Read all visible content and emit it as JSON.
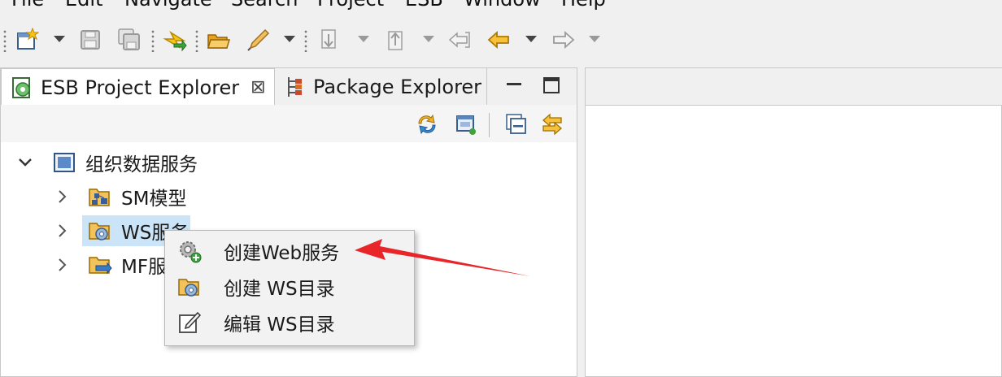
{
  "menubar": {
    "items": [
      "File",
      "Edit",
      "Navigate",
      "Search",
      "Project",
      "ESB",
      "Window",
      "Help"
    ]
  },
  "toolbar": {
    "icons": [
      "new-wizard-icon",
      "save-icon",
      "save-all-icon",
      "build-icon",
      "open-folder-icon",
      "pen-icon",
      "next-annotation-icon",
      "previous-annotation-icon",
      "last-edit-location-icon",
      "back-arrow-icon",
      "forward-arrow-icon"
    ]
  },
  "explorer": {
    "tabs": [
      {
        "label": "ESB Project Explorer",
        "active": true
      },
      {
        "label": "Package Explorer",
        "active": false
      }
    ],
    "close_glyph": "⊠",
    "tree": {
      "root": {
        "label": "组织数据服务",
        "expanded": true
      },
      "children": [
        {
          "label": "SM模型",
          "expanded": false,
          "selected": false
        },
        {
          "label": "WS服务",
          "expanded": false,
          "selected": true
        },
        {
          "label": "MF服务",
          "expanded": false,
          "selected": false
        }
      ]
    }
  },
  "context_menu": {
    "items": [
      {
        "label": "创建Web服务",
        "icon": "gear-add-icon"
      },
      {
        "label": "创建 WS目录",
        "icon": "folder-gear-icon"
      },
      {
        "label": "编辑 WS目录",
        "icon": "edit-pencil-icon"
      }
    ]
  },
  "colors": {
    "selection": "#cce4f7",
    "annotation_arrow": "#e8262a",
    "accent_orange": "#e8a020"
  }
}
